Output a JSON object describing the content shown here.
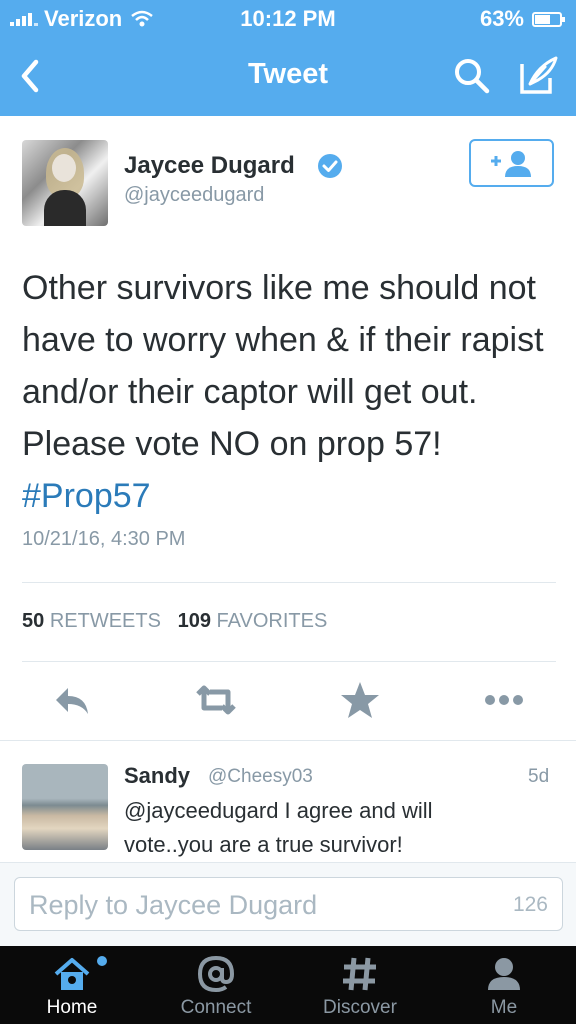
{
  "status_bar": {
    "carrier": "Verizon",
    "time": "10:12 PM",
    "battery": "63%",
    "battery_level": 0.63
  },
  "nav": {
    "title": "Tweet"
  },
  "tweet": {
    "name": "Jaycee Dugard",
    "handle": "@jayceedugard",
    "text_plain": "Other survivors like me should not have to worry when & if their rapist and/or their captor will get out. Please vote NO on prop 57!",
    "hashtag": "#Prop57",
    "date": "10/21/16, 4:30 PM",
    "retweets_count": "50",
    "retweets_label": "RETWEETS",
    "favorites_count": "109",
    "favorites_label": "FAVORITES"
  },
  "reply": {
    "name": "Sandy",
    "handle": "@Cheesy03",
    "time": "5d",
    "text": "@jayceedugard I agree and will vote..you are a  true survivor!"
  },
  "reply_input": {
    "placeholder": "Reply to Jaycee Dugard",
    "char_count": "126"
  },
  "tabs": [
    {
      "label": "Home",
      "icon": "home-icon",
      "active": true
    },
    {
      "label": "Connect",
      "icon": "at-icon",
      "active": false
    },
    {
      "label": "Discover",
      "icon": "hash-icon",
      "active": false
    },
    {
      "label": "Me",
      "icon": "person-icon",
      "active": false
    }
  ],
  "colors": {
    "brand": "#55acee",
    "link": "#2b7bb9",
    "text": "#292f33",
    "muted": "#8899a6",
    "tabbar": "#0a0a0a"
  }
}
